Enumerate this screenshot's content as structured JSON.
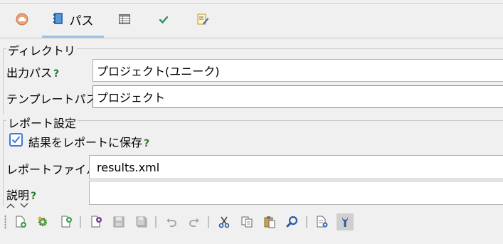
{
  "tabs": [
    {
      "name": "general",
      "label": "",
      "icon": "gear-badge-icon"
    },
    {
      "name": "path",
      "label": "パス",
      "icon": "notebook-icon",
      "active": true
    },
    {
      "name": "table",
      "label": "",
      "icon": "table-icon"
    },
    {
      "name": "check",
      "label": "",
      "icon": "check-icon"
    },
    {
      "name": "edit",
      "label": "",
      "icon": "edit-page-icon"
    }
  ],
  "directory": {
    "title": "ディレクトリ",
    "output_label": "出力パス",
    "output_value": "プロジェクト(ユニーク)",
    "template_label": "テンプレートパス",
    "template_value": "プロジェクト"
  },
  "report": {
    "title": "レポート設定",
    "save_checkbox_label": "結果をレポートに保存",
    "save_checked": true,
    "file_label": "レポートファイル",
    "file_value": "results.xml",
    "description_label": "説明",
    "description_value": ""
  },
  "help_mark": "?",
  "toolbar": [
    "new-file-icon",
    "gear-add-icon",
    "export-icon",
    "page-settings-icon",
    "save-icon",
    "save-all-icon",
    "undo-icon",
    "redo-icon",
    "cut-icon",
    "copy-icon",
    "paste-icon",
    "search-icon",
    "properties-icon",
    "wrench-icon"
  ],
  "colors": {
    "accent": "#3d7bd8",
    "help": "#2b7a2b",
    "active_tab": "#9ec1e6"
  }
}
